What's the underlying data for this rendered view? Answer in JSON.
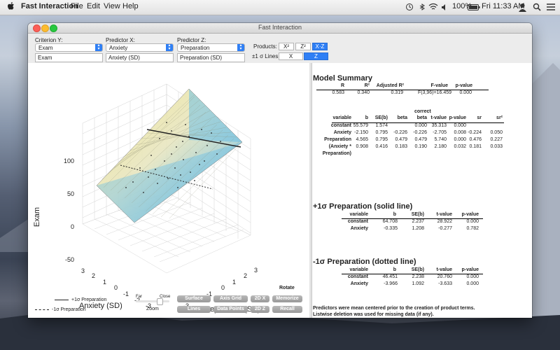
{
  "menubar": {
    "app_name": "Fast Interaction",
    "items": [
      "File",
      "Edit",
      "View",
      "Help"
    ],
    "battery": "100%",
    "clock": "Fri 11:33 AM"
  },
  "window": {
    "title": "Fast Interaction",
    "criterion_y": {
      "label": "Criterion Y:",
      "value": "Exam",
      "display": "Exam"
    },
    "predictor_x": {
      "label": "Predictor X:",
      "value": "Anxiety",
      "display": "Anxiety (SD)"
    },
    "predictor_z": {
      "label": "Predictor Z:",
      "value": "Preparation",
      "display": "Preparation (SD)"
    },
    "products_label": "Products:",
    "products": [
      "X²",
      "Z²",
      "X·Z"
    ],
    "products_selected": "X·Z",
    "lines_label": "±1 σ Lines:",
    "lines": [
      "X",
      "Z"
    ],
    "lines_selected": "Z"
  },
  "plot": {
    "y_axis_label": "Exam",
    "x_axis_label": "Anxiety (SD)",
    "z_axis_label": "Preparation (SD)",
    "y_ticks": [
      "100",
      "50",
      "0",
      "-50"
    ],
    "x_ticks": [
      "3",
      "2",
      "1",
      "0",
      "-1",
      "-2",
      "-3"
    ],
    "z_ticks": [
      "3",
      "2",
      "1",
      "0",
      "-1",
      "-2",
      "-3"
    ],
    "colors": {
      "surface_high": "#efe48a",
      "surface_low": "#56b6ea",
      "grid": "#c8c8c8"
    }
  },
  "legend": {
    "solid": "+1σ Preparation",
    "dotted": "-1σ Preparation"
  },
  "zoom": {
    "label": "Zoom",
    "far": "Far",
    "close": "Close"
  },
  "buttons": {
    "rotate": "Rotate",
    "surface": "Surface",
    "axis_grid": "Axis Grid",
    "twod_x": "2D X",
    "memorize": "Memorize",
    "lines": "Lines",
    "data_points": "Data Points",
    "twod_z": "2D Z",
    "recall": "Recall"
  },
  "model_summary": {
    "title": "Model Summary",
    "headers": [
      "R",
      "R²",
      "Adjusted R²",
      "F-value",
      "p-value"
    ],
    "row": [
      "0.583",
      "0.340",
      "0.319",
      "F(3,96)=16.459",
      "0.000"
    ]
  },
  "coefficients": {
    "headers": [
      "variable",
      "b",
      "SE(b)",
      "beta",
      "correct beta",
      "t-value",
      "p-value",
      "sr",
      "sr²"
    ],
    "correct_top": "correct",
    "correct_bottom": "beta",
    "rows": [
      [
        "constant",
        "55.579",
        "1.574",
        "",
        "0.000",
        "35.313",
        "0.000",
        "",
        ""
      ],
      [
        "Anxiety",
        "-2.150",
        "0.795",
        "-0.226",
        "-0.226",
        "-2.705",
        "0.008",
        "-0.224",
        "0.050"
      ],
      [
        "Preparation",
        "4.565",
        "0.795",
        "0.479",
        "0.479",
        "5.740",
        "0.000",
        "0.476",
        "0.227"
      ],
      [
        "(Anxiety *",
        "0.908",
        "0.416",
        "0.183",
        "0.190",
        "2.180",
        "0.032",
        "0.181",
        "0.033"
      ]
    ],
    "row4_cont": "Preparation)"
  },
  "plus_section": {
    "title": "+1σ Preparation (solid line)",
    "headers": [
      "variable",
      "b",
      "SE(b)",
      "t-value",
      "p-value"
    ],
    "rows": [
      [
        "constant",
        "64.708",
        "2.237",
        "28.922",
        "0.000"
      ],
      [
        "Anxiety",
        "-0.335",
        "1.208",
        "-0.277",
        "0.782"
      ]
    ]
  },
  "minus_section": {
    "title": "-1σ Preparation (dotted line)",
    "headers": [
      "variable",
      "b",
      "SE(b)",
      "t-value",
      "p-value"
    ],
    "rows": [
      [
        "constant",
        "46.451",
        "2.238",
        "20.760",
        "0.000"
      ],
      [
        "Anxiety",
        "-3.966",
        "1.092",
        "-3.633",
        "0.000"
      ]
    ]
  },
  "notes": [
    "Predictors were mean centered prior to the creation of product terms.",
    "Listwise deletion was used for missing data (if any)."
  ]
}
